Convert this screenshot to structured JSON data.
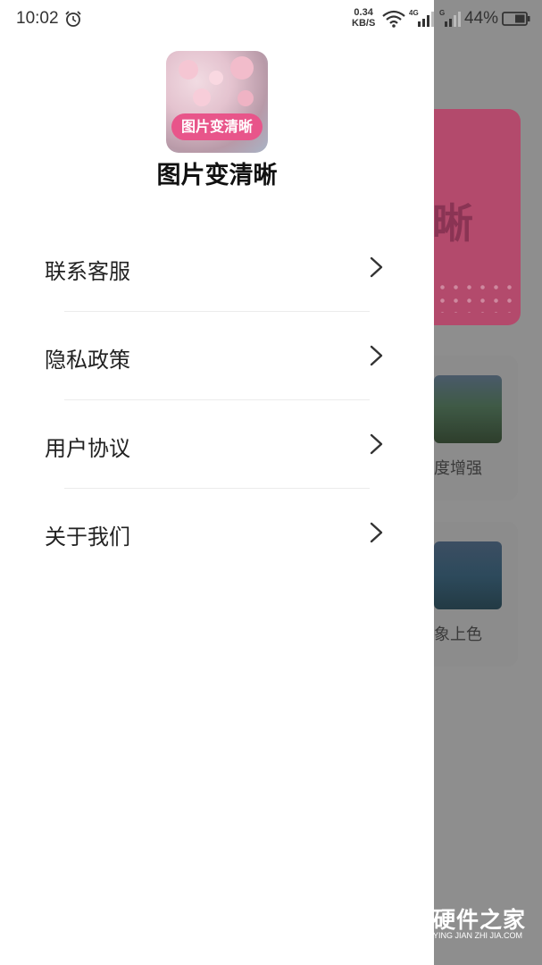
{
  "status_bar": {
    "time": "10:02",
    "net_speed_value": "0.34",
    "net_speed_unit": "KB/S",
    "sim1_tag": "4G",
    "sim2_tag": "G",
    "battery": "44%"
  },
  "drawer": {
    "app_name": "图片变清晰",
    "logo_text": "图片变清晰",
    "menu": [
      {
        "label": "联系客服"
      },
      {
        "label": "隐私政策"
      },
      {
        "label": "用户协议"
      },
      {
        "label": "关于我们"
      }
    ]
  },
  "background": {
    "banner_glyph": "晰",
    "cards": [
      {
        "label": "度增强"
      },
      {
        "label": "象上色"
      }
    ]
  },
  "watermark": {
    "title": "硬件之家",
    "subtitle": "YING JIAN ZHI JIA.COM"
  },
  "colors": {
    "accent": "#e8558a",
    "overlay": "#8e8e8e"
  }
}
